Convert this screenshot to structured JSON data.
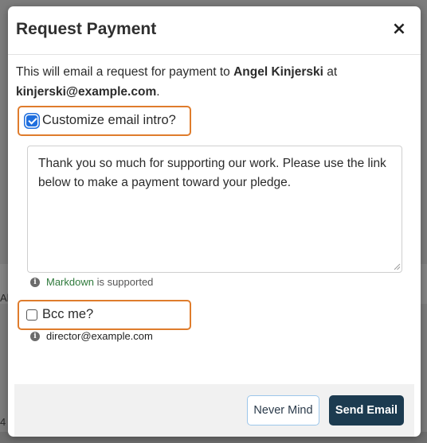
{
  "modal": {
    "title": "Request Payment",
    "close_symbol": "×",
    "intro_prefix": "This will email a request for payment to ",
    "recipient_name": "Angel Kinjerski",
    "intro_middle": " at",
    "recipient_email": "kinjerski@example.com",
    "intro_suffix": "."
  },
  "customize": {
    "label": "Customize email intro?",
    "checked": true,
    "textarea_value": "Thank you so much for supporting our work. Please use the link below to make a payment toward your pledge."
  },
  "markdown_note": {
    "link": "Markdown",
    "text": " is supported",
    "icon": "info-icon"
  },
  "bcc": {
    "label": "Bcc me?",
    "checked": false,
    "email": "director@example.com",
    "icon": "info-icon"
  },
  "footer": {
    "cancel_label": "Never Mind",
    "submit_label": "Send Email"
  },
  "background": {
    "frag_left": "Al",
    "frag_bottom": "4"
  },
  "colors": {
    "highlight_border": "#df7c2c",
    "primary_button": "#1c3b50",
    "checkbox_checked": "#1f6fde",
    "markdown_link": "#2f7a3c"
  }
}
